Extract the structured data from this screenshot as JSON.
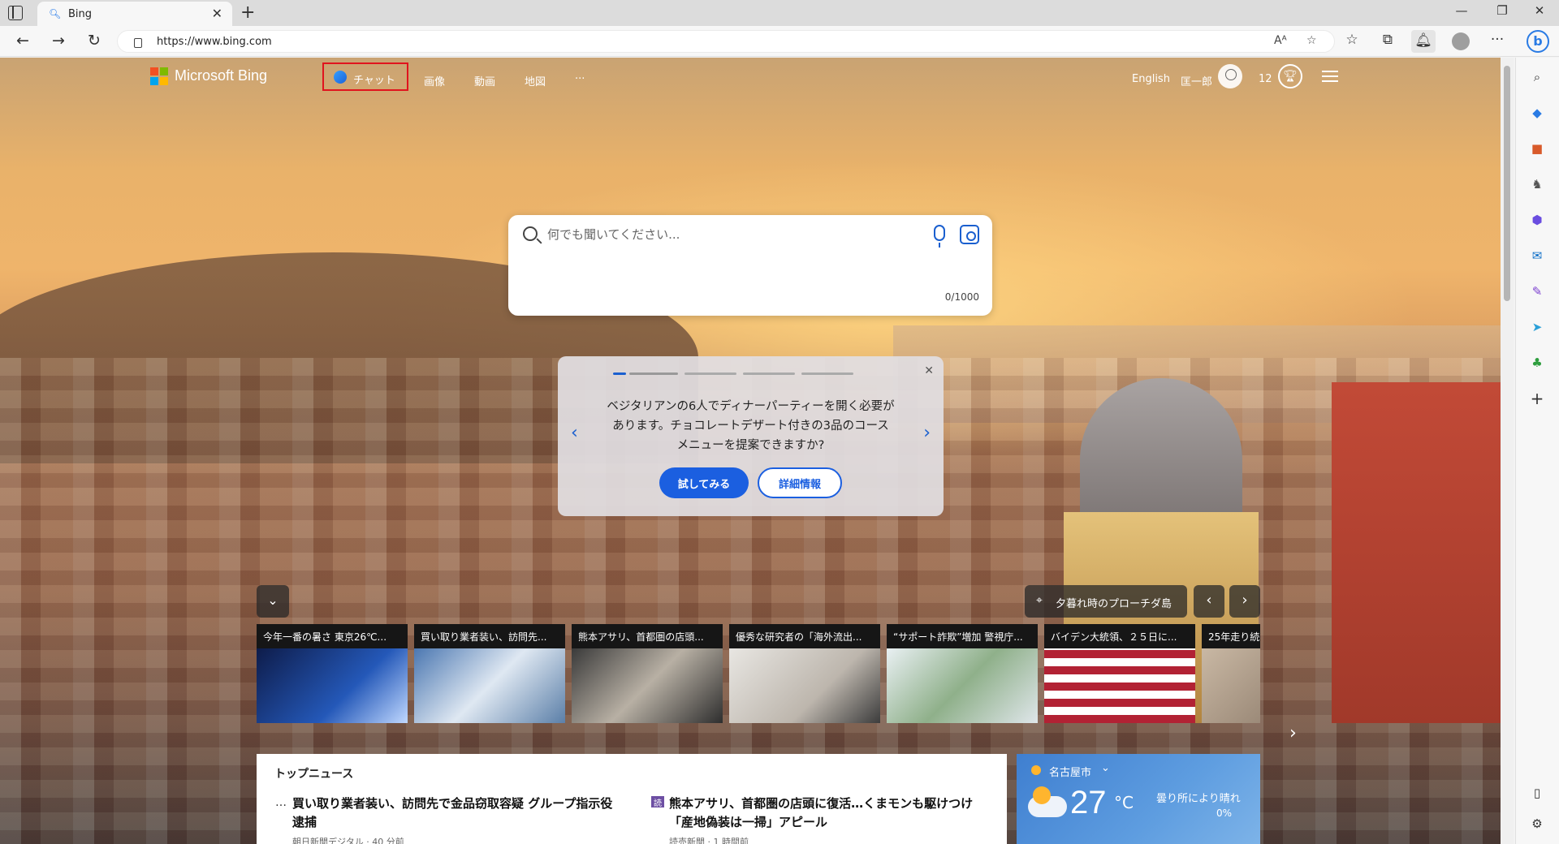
{
  "browser": {
    "tab_title": "Bing",
    "tab_close": "✕",
    "new_tab": "+",
    "url": "https://www.bing.com",
    "window": {
      "minimize": "—",
      "restore": "❐",
      "close": "✕"
    },
    "nav": {
      "back": "←",
      "forward": "→",
      "reload": "↻"
    },
    "toolbar_more": "···"
  },
  "header": {
    "brand": "Microsoft Bing",
    "nav": {
      "chat": "チャット",
      "images": "画像",
      "videos": "動画",
      "maps": "地図",
      "more": "···"
    },
    "language": "English",
    "user_name": "匡一郎",
    "points": "12"
  },
  "search": {
    "placeholder": "何でも聞いてください...",
    "char_count": "0/1000"
  },
  "suggestion": {
    "text": "ベジタリアンの6人でディナーパーティーを開く必要があります。チョコレートデザート付きの3品のコースメニューを提案できますか?",
    "try_button": "試してみる",
    "more_button": "詳細情報",
    "active_page": 1,
    "page_count": 4
  },
  "image_info": {
    "location": "夕暮れ時のプローチダ島"
  },
  "news_strip": [
    {
      "caption": "今年一番の暑さ 東京26℃...",
      "color": "#1a2f6a"
    },
    {
      "caption": "買い取り業者装い、訪問先...",
      "color": "#5b7fa8"
    },
    {
      "caption": "熊本アサリ、首都圏の店頭...",
      "color": "#4b4b4b"
    },
    {
      "caption": "優秀な研究者の「海外流出...",
      "color": "#cfcac3"
    },
    {
      "caption": "“サポート詐欺”増加 警視庁...",
      "color": "#dfe6ea"
    },
    {
      "caption": "バイデン大統領、２５日に...",
      "color": "#b23a3a"
    },
    {
      "caption": "25年走り続",
      "color": "#7c6a5a"
    }
  ],
  "top_news": {
    "heading": "トップニュース",
    "items": [
      {
        "headline": "買い取り業者装い、訪問先で金品窃取容疑 グループ指示役逮捕",
        "meta": "朝日新聞デジタル · 40 分前"
      },
      {
        "headline": "熊本アサリ、首都圏の店頭に復活…くまモンも駆けつけ「産地偽装は一掃」アピール",
        "meta": "読売新聞 · 1 時間前"
      }
    ]
  },
  "weather": {
    "city": "名古屋市",
    "temperature": "27",
    "unit": "°C",
    "condition": "曇り所により晴れ",
    "precipitation": "0%"
  },
  "colors": {
    "accent": "#1b5fe0",
    "highlight_border": "#e0141e"
  }
}
